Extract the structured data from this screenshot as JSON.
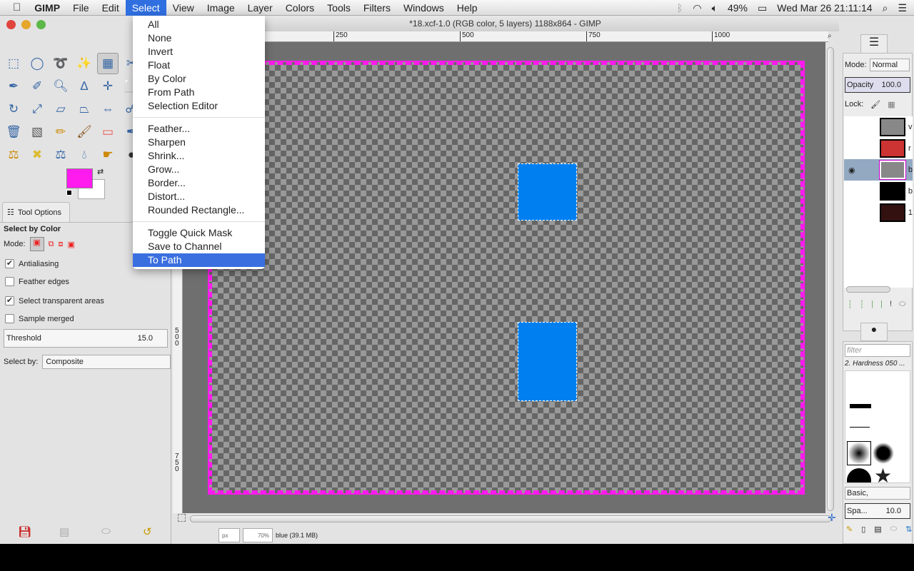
{
  "menubar": {
    "app": "GIMP",
    "items": [
      "File",
      "Edit",
      "Select",
      "View",
      "Image",
      "Layer",
      "Colors",
      "Tools",
      "Filters",
      "Windows",
      "Help"
    ],
    "active": "Select"
  },
  "status": {
    "battery": "49%",
    "datetime": "Wed Mar 26  21:11:14"
  },
  "window": {
    "title": "*18.xcf-1.0 (RGB color, 5 layers) 1188x864 - GIMP"
  },
  "rulers": {
    "h": [
      "250",
      "500",
      "750",
      "1000"
    ],
    "v": [
      "500",
      "750"
    ]
  },
  "select_menu": {
    "group1": [
      "All",
      "None",
      "Invert",
      "Float",
      "By Color",
      "From Path",
      "Selection Editor"
    ],
    "group2": [
      "Feather...",
      "Sharpen",
      "Shrink...",
      "Grow...",
      "Border...",
      "Distort...",
      "Rounded Rectangle..."
    ],
    "group3": [
      "Toggle Quick Mask",
      "Save to Channel",
      "To Path"
    ],
    "highlighted": "To Path"
  },
  "colors": {
    "foreground": "#ff1aed",
    "background": "#ffffff",
    "selection_fill": "#0080f0"
  },
  "tool_options": {
    "tab": "Tool Options",
    "heading": "Select by Color",
    "mode_label": "Mode:",
    "antialiasing": {
      "label": "Antialiasing",
      "checked": true
    },
    "feather": {
      "label": "Feather edges",
      "checked": false
    },
    "transparent": {
      "label": "Select transparent areas",
      "checked": true
    },
    "merged": {
      "label": "Sample merged",
      "checked": false
    },
    "threshold_label": "Threshold",
    "threshold_value": "15.0",
    "select_by_label": "Select by:",
    "select_by_value": "Composite"
  },
  "statusbar": {
    "unit": "px",
    "zoom": "70%",
    "info": "blue (39.1 MB)"
  },
  "layers": {
    "mode_label": "Mode:",
    "mode": "Normal",
    "opacity_label": "Opacity",
    "opacity": "100.0",
    "lock_label": "Lock:",
    "names": [
      "v",
      "r",
      "b",
      "b",
      "1"
    ],
    "selected_index": 2
  },
  "brushes": {
    "filter_placeholder": "filter",
    "current": "2. Hardness 050 ...",
    "tag": "Basic,",
    "spacing_label": "Spa...",
    "spacing": "10.0"
  }
}
